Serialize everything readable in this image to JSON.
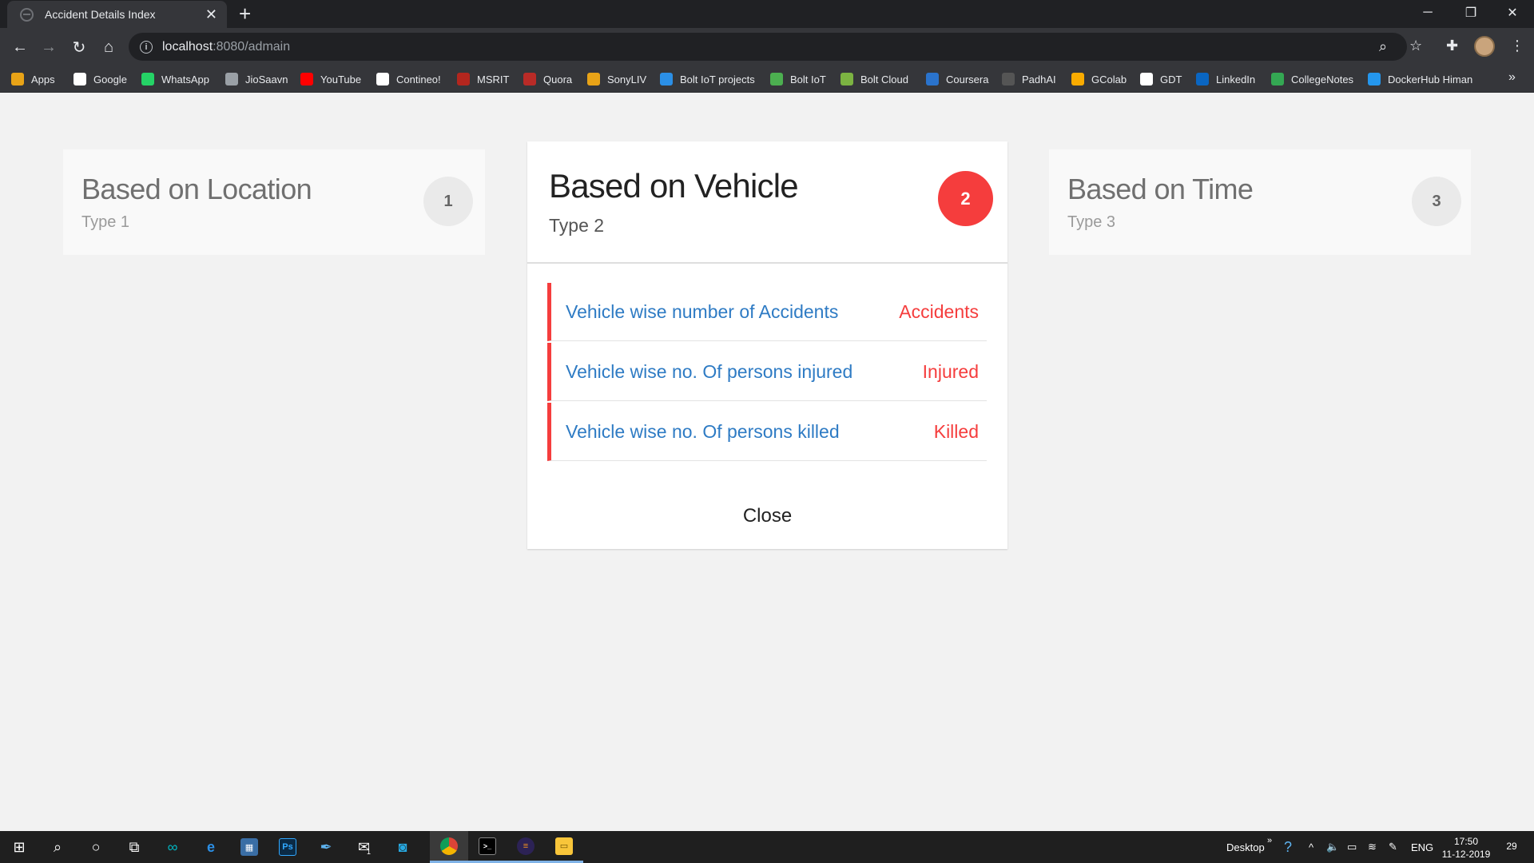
{
  "browser": {
    "tab_title": "Accident Details Index",
    "url_host": "localhost",
    "url_path": ":8080/admain",
    "bookmarks": [
      {
        "label": "Apps",
        "icon": "apps-grid-icon",
        "color": "#e8a317"
      },
      {
        "label": "Google",
        "icon": "google-icon",
        "color": "#ffffff"
      },
      {
        "label": "WhatsApp",
        "icon": "whatsapp-icon",
        "color": "#25d366"
      },
      {
        "label": "JioSaavn",
        "icon": "jiosaavn-icon",
        "color": "#9aa0a6"
      },
      {
        "label": "YouTube",
        "icon": "youtube-icon",
        "color": "#ff0000"
      },
      {
        "label": "Contineo!",
        "icon": "contineo-icon",
        "color": "#ffffff"
      },
      {
        "label": "MSRIT",
        "icon": "msrit-icon",
        "color": "#b3261e"
      },
      {
        "label": "Quora",
        "icon": "quora-icon",
        "color": "#b92b27"
      },
      {
        "label": "SonyLIV",
        "icon": "sonyliv-icon",
        "color": "#e8a317"
      },
      {
        "label": "Bolt IoT projects",
        "icon": "bolt-projects-icon",
        "color": "#2b8fe6"
      },
      {
        "label": "Bolt IoT",
        "icon": "bolt-iot-icon",
        "color": "#4caf50"
      },
      {
        "label": "Bolt Cloud",
        "icon": "bolt-cloud-icon",
        "color": "#7cb342"
      },
      {
        "label": "Coursera",
        "icon": "coursera-icon",
        "color": "#2a73cc"
      },
      {
        "label": "PadhAI",
        "icon": "padhai-icon",
        "color": "#555555"
      },
      {
        "label": "GColab",
        "icon": "gcolab-icon",
        "color": "#f9ab00"
      },
      {
        "label": "GDT",
        "icon": "gdt-icon",
        "color": "#ffffff"
      },
      {
        "label": "LinkedIn",
        "icon": "linkedin-icon",
        "color": "#0a66c2"
      },
      {
        "label": "CollegeNotes",
        "icon": "drive-icon",
        "color": "#34a853"
      },
      {
        "label": "DockerHub Himan",
        "icon": "dockerhub-icon",
        "color": "#2496ed"
      }
    ]
  },
  "cards": [
    {
      "title": "Based on Location",
      "subtitle": "Type 1",
      "number": "1"
    },
    {
      "title": "Based on Vehicle",
      "subtitle": "Type 2",
      "number": "2"
    },
    {
      "title": "Based on Time",
      "subtitle": "Type 3",
      "number": "3"
    }
  ],
  "active_items": [
    {
      "link": "Vehicle wise number of Accidents",
      "tag": "Accidents"
    },
    {
      "link": "Vehicle wise no. Of persons injured",
      "tag": "Injured"
    },
    {
      "link": "Vehicle wise no. Of persons killed",
      "tag": "Killed"
    }
  ],
  "close_label": "Close",
  "taskbar": {
    "desktop_label": "Desktop",
    "lang": "ENG",
    "time": "17:50",
    "date": "11-12-2019",
    "notifications": "29",
    "mail_badge": "1"
  },
  "colors": {
    "accent": "#f53d3d",
    "link": "#2e7bc4"
  }
}
